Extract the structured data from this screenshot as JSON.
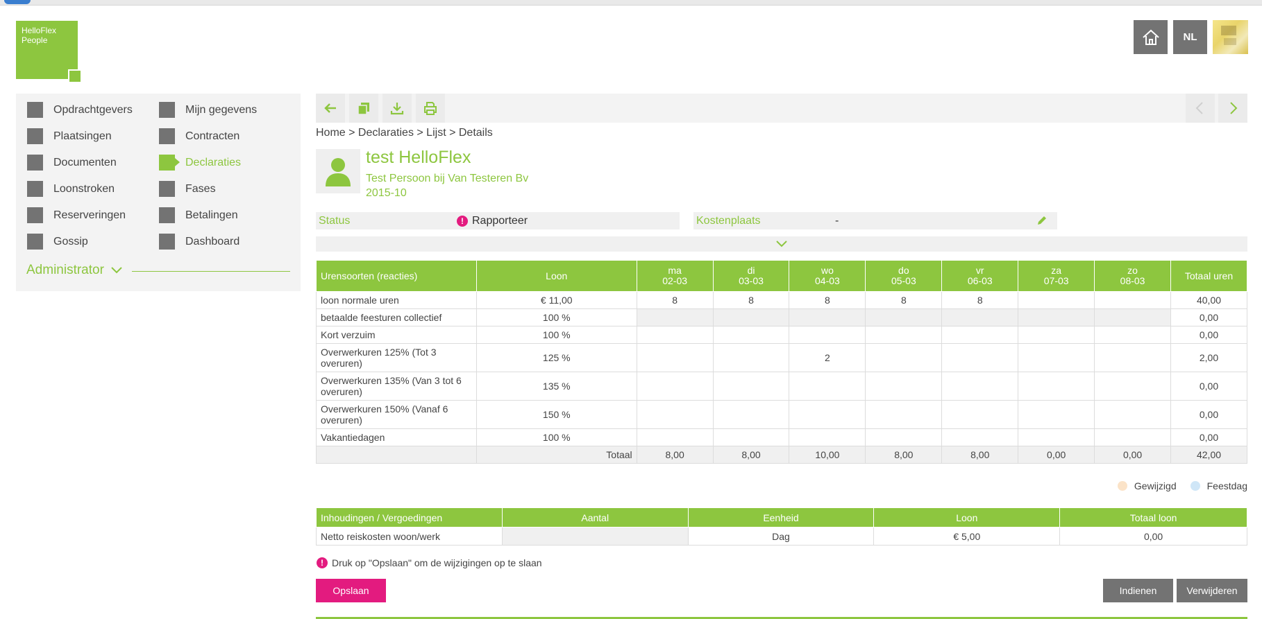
{
  "logo": {
    "line1": "HelloFlex",
    "line2": "People"
  },
  "header": {
    "language": "NL"
  },
  "sidebar": {
    "col1": [
      "Opdrachtgevers",
      "Plaatsingen",
      "Documenten",
      "Loonstroken",
      "Reserveringen",
      "Gossip"
    ],
    "col2": [
      "Mijn gegevens",
      "Contracten",
      "Declaraties",
      "Fases",
      "Betalingen",
      "Dashboard"
    ],
    "active": "Declaraties",
    "admin_label": "Administrator"
  },
  "breadcrumb": "Home > Declaraties > Lijst > Details",
  "person": {
    "name": "test HelloFlex",
    "subtitle": "Test Persoon bij Van Testeren Bv",
    "period": "2015-10"
  },
  "status": {
    "label": "Status",
    "value": "Rapporteer"
  },
  "kostenplaats": {
    "label": "Kostenplaats",
    "value": "-"
  },
  "hours_table": {
    "headers": {
      "type": "Urensoorten (reacties)",
      "wage": "Loon",
      "total": "Totaal uren",
      "days": [
        {
          "day": "ma",
          "date": "02-03"
        },
        {
          "day": "di",
          "date": "03-03"
        },
        {
          "day": "wo",
          "date": "04-03"
        },
        {
          "day": "do",
          "date": "05-03"
        },
        {
          "day": "vr",
          "date": "06-03"
        },
        {
          "day": "za",
          "date": "07-03"
        },
        {
          "day": "zo",
          "date": "08-03"
        }
      ]
    },
    "rows": [
      {
        "name": "loon normale uren",
        "wage": "€ 11,00",
        "days": [
          "8",
          "8",
          "8",
          "8",
          "8",
          "",
          ""
        ],
        "total": "40,00",
        "gray": false,
        "tall": false
      },
      {
        "name": "betaalde feesturen collectief",
        "wage": "100 %",
        "days": [
          "",
          "",
          "",
          "",
          "",
          "",
          ""
        ],
        "total": "0,00",
        "gray": true,
        "tall": false
      },
      {
        "name": "Kort verzuim",
        "wage": "100 %",
        "days": [
          "",
          "",
          "",
          "",
          "",
          "",
          ""
        ],
        "total": "0,00",
        "gray": false,
        "tall": false
      },
      {
        "name": "Overwerkuren 125% (Tot 3 overuren)",
        "wage": "125 %",
        "days": [
          "",
          "",
          "2",
          "",
          "",
          "",
          ""
        ],
        "total": "2,00",
        "gray": false,
        "tall": true
      },
      {
        "name": "Overwerkuren 135% (Van 3 tot 6 overuren)",
        "wage": "135 %",
        "days": [
          "",
          "",
          "",
          "",
          "",
          "",
          ""
        ],
        "total": "0,00",
        "gray": false,
        "tall": true
      },
      {
        "name": "Overwerkuren 150% (Vanaf 6 overuren)",
        "wage": "150 %",
        "days": [
          "",
          "",
          "",
          "",
          "",
          "",
          ""
        ],
        "total": "0,00",
        "gray": false,
        "tall": true
      },
      {
        "name": "Vakantiedagen",
        "wage": "100 %",
        "days": [
          "",
          "",
          "",
          "",
          "",
          "",
          ""
        ],
        "total": "0,00",
        "gray": false,
        "tall": false
      }
    ],
    "totals": {
      "label": "Totaal",
      "days": [
        "8,00",
        "8,00",
        "10,00",
        "8,00",
        "8,00",
        "0,00",
        "0,00"
      ],
      "total": "42,00"
    }
  },
  "legend": {
    "changed": {
      "label": "Gewijzigd",
      "color": "#fbe3c8"
    },
    "holiday": {
      "label": "Feestdag",
      "color": "#cfe6f7"
    }
  },
  "expenses_table": {
    "headers": [
      "Inhoudingen / Vergoedingen",
      "Aantal",
      "Eenheid",
      "Loon",
      "Totaal loon"
    ],
    "rows": [
      {
        "name": "Netto reiskosten woon/werk",
        "amount": "",
        "unit": "Dag",
        "wage": "€ 5,00",
        "total": "0,00"
      }
    ]
  },
  "save_message": "Druk op \"Opslaan\" om de wijzigingen op te slaan",
  "buttons": {
    "save": "Opslaan",
    "submit": "Indienen",
    "delete": "Verwijderen"
  },
  "colors": {
    "accent": "#8dc63f",
    "error": "#e31b7f",
    "button_gray": "#737373"
  }
}
